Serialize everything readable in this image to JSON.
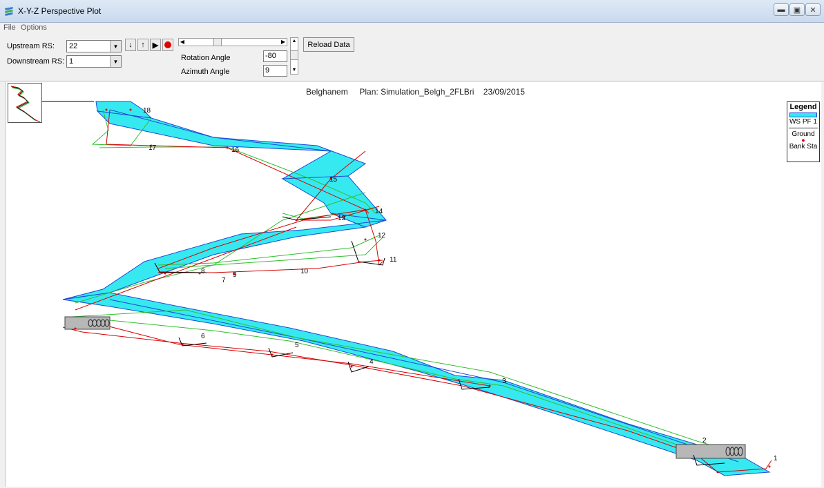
{
  "window": {
    "title": "X-Y-Z Perspective Plot"
  },
  "menu": {
    "items": [
      "File",
      "Options"
    ]
  },
  "toolbar": {
    "upstream_label": "Upstream RS:",
    "upstream_value": "22",
    "downstream_label": "Downstream RS:",
    "downstream_value": "1",
    "rotation_label": "Rotation Angle",
    "rotation_value": "-80",
    "azimuth_label": "Azimuth Angle",
    "azimuth_value": "9",
    "reload_label": "Reload Data"
  },
  "plot": {
    "header": "Belghanem     Plan: Simulation_Belgh_2FLBri    23/09/2015",
    "station_labels": [
      "18",
      "17",
      "16",
      "15",
      "14",
      "13",
      "12",
      "11",
      "10",
      "9",
      "8",
      "7",
      "6",
      "5",
      "4",
      "3",
      "2",
      "1"
    ]
  },
  "legend": {
    "title": "Legend",
    "ws_label": "WS PF 1",
    "ground_label": "Ground",
    "bank_label": "Bank Sta"
  },
  "colors": {
    "water": "#36e9f0",
    "water_edge": "#1a4bd6",
    "ground": "#d40000",
    "ground_alt": "#2fbf2f"
  }
}
